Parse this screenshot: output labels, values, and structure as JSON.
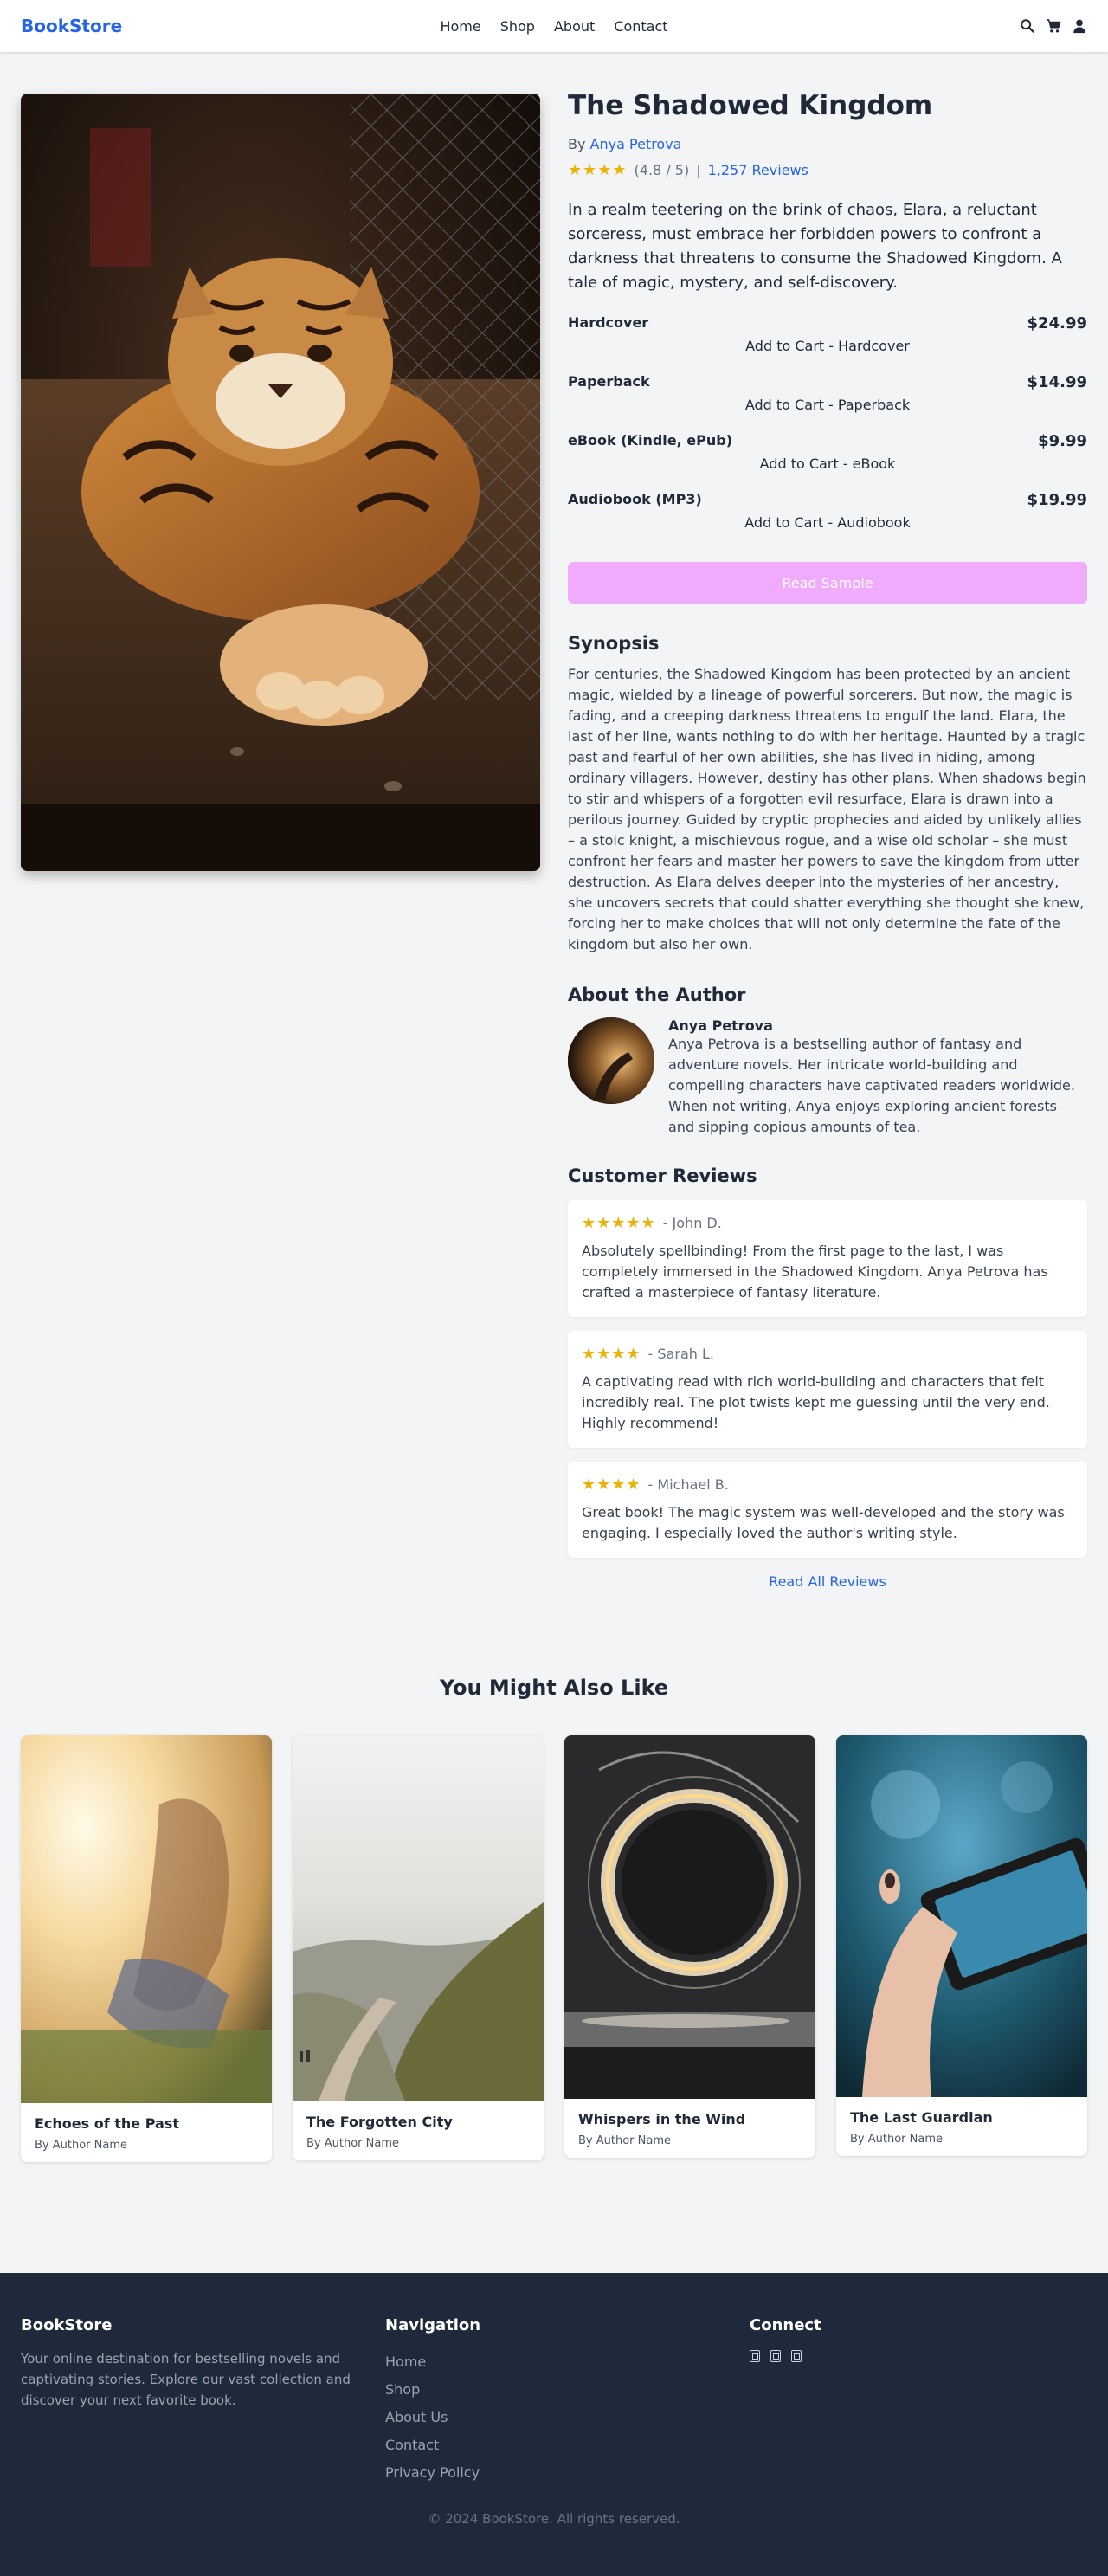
{
  "header": {
    "brand": "BookStore",
    "nav": [
      "Home",
      "Shop",
      "About",
      "Contact"
    ],
    "icons": [
      "search-icon",
      "cart-icon",
      "user-icon"
    ]
  },
  "book": {
    "title": "The Shadowed Kingdom",
    "by": "By",
    "author": "Anya Petrova",
    "stars": "★★★★",
    "rating": "(4.8 / 5)",
    "separator": "|",
    "reviews_link": "1,257 Reviews",
    "description": "In a realm teetering on the brink of chaos, Elara, a reluctant sorceress, must embrace her forbidden powers to confront a darkness that threatens to consume the Shadowed Kingdom. A tale of magic, mystery, and self-discovery.",
    "formats": [
      {
        "name": "Hardcover",
        "price": "$24.99",
        "button": "Add to Cart - Hardcover"
      },
      {
        "name": "Paperback",
        "price": "$14.99",
        "button": "Add to Cart - Paperback"
      },
      {
        "name": "eBook (Kindle, ePub)",
        "price": "$9.99",
        "button": "Add to Cart - eBook"
      },
      {
        "name": "Audiobook (MP3)",
        "price": "$19.99",
        "button": "Add to Cart - Audiobook"
      }
    ],
    "sample_button": "Read Sample",
    "accent_color": "#2563eb",
    "sample_color": "#f0abfc",
    "star_color": "#eab308"
  },
  "synopsis": {
    "heading": "Synopsis",
    "text": "For centuries, the Shadowed Kingdom has been protected by an ancient magic, wielded by a lineage of powerful sorcerers. But now, the magic is fading, and a creeping darkness threatens to engulf the land. Elara, the last of her line, wants nothing to do with her heritage. Haunted by a tragic past and fearful of her own abilities, she has lived in hiding, among ordinary villagers. However, destiny has other plans. When shadows begin to stir and whispers of a forgotten evil resurface, Elara is drawn into a perilous journey. Guided by cryptic prophecies and aided by unlikely allies – a stoic knight, a mischievous rogue, and a wise old scholar – she must confront her fears and master her powers to save the kingdom from utter destruction. As Elara delves deeper into the mysteries of her ancestry, she uncovers secrets that could shatter everything she thought she knew, forcing her to make choices that will not only determine the fate of the kingdom but also her own."
  },
  "about_author": {
    "heading": "About the Author",
    "name": "Anya Petrova",
    "bio": "Anya Petrova is a bestselling author of fantasy and adventure novels. Her intricate world-building and compelling characters have captivated readers worldwide. When not writing, Anya enjoys exploring ancient forests and sipping copious amounts of tea."
  },
  "reviews": {
    "heading": "Customer Reviews",
    "items": [
      {
        "stars": "★★★★★",
        "author": "- John D.",
        "text": "Absolutely spellbinding! From the first page to the last, I was completely immersed in the Shadowed Kingdom. Anya Petrova has crafted a masterpiece of fantasy literature."
      },
      {
        "stars": "★★★★",
        "author": "- Sarah L.",
        "text": "A captivating read with rich world-building and characters that felt incredibly real. The plot twists kept me guessing until the very end. Highly recommend!"
      },
      {
        "stars": "★★★★",
        "author": "- Michael B.",
        "text": "Great book! The magic system was well-developed and the story was engaging. I especially loved the author's writing style."
      }
    ],
    "read_all": "Read All Reviews"
  },
  "also_like": {
    "heading": "You Might Also Like",
    "books": [
      {
        "title": "Echoes of the Past",
        "author": "By Author Name"
      },
      {
        "title": "The Forgotten City",
        "author": "By Author Name"
      },
      {
        "title": "Whispers in the Wind",
        "author": "By Author Name"
      },
      {
        "title": "The Last Guardian",
        "author": "By Author Name"
      }
    ]
  },
  "footer": {
    "brand": "BookStore",
    "about": "Your online destination for bestselling novels and captivating stories. Explore our vast collection and discover your next favorite book.",
    "nav_heading": "Navigation",
    "nav": [
      "Home",
      "Shop",
      "About Us",
      "Contact",
      "Privacy Policy"
    ],
    "connect_heading": "Connect",
    "social_icons": [
      "social-icon-1",
      "social-icon-2",
      "social-icon-3"
    ],
    "copyright": "© 2024 BookStore. All rights reserved."
  }
}
